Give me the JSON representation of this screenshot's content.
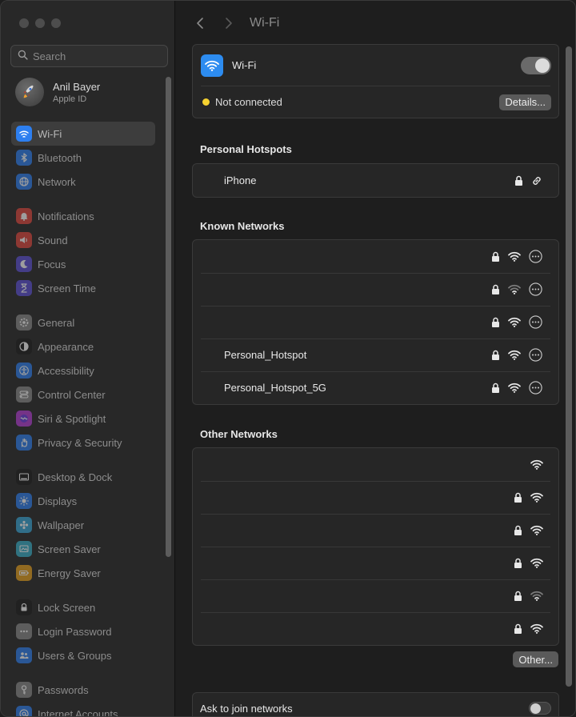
{
  "window": {
    "title": "Wi-Fi"
  },
  "search": {
    "placeholder": "Search"
  },
  "profile": {
    "name": "Anil Bayer",
    "subtitle": "Apple ID"
  },
  "sidebar": {
    "groups": [
      [
        {
          "label": "Wi-Fi",
          "icon": "wifi-icon",
          "color": "#2d7ff0",
          "active": true
        },
        {
          "label": "Bluetooth",
          "icon": "bluetooth-icon",
          "color": "#2d7ff0"
        },
        {
          "label": "Network",
          "icon": "globe-icon",
          "color": "#2d7ff0"
        }
      ],
      [
        {
          "label": "Notifications",
          "icon": "bell-icon",
          "color": "#e0463d"
        },
        {
          "label": "Sound",
          "icon": "speaker-icon",
          "color": "#e0463d"
        },
        {
          "label": "Focus",
          "icon": "moon-icon",
          "color": "#5b4fd6"
        },
        {
          "label": "Screen Time",
          "icon": "hourglass-icon",
          "color": "#5b4fd6"
        }
      ],
      [
        {
          "label": "General",
          "icon": "gear-icon",
          "color": "#8a8a8a"
        },
        {
          "label": "Appearance",
          "icon": "appearance-icon",
          "color": "#1c1c1c"
        },
        {
          "label": "Accessibility",
          "icon": "accessibility-icon",
          "color": "#2d7ff0"
        },
        {
          "label": "Control Center",
          "icon": "control-center-icon",
          "color": "#8a8a8a"
        },
        {
          "label": "Siri & Spotlight",
          "icon": "siri-icon",
          "color": "#b43dd6"
        },
        {
          "label": "Privacy & Security",
          "icon": "hand-icon",
          "color": "#2d7ff0"
        }
      ],
      [
        {
          "label": "Desktop & Dock",
          "icon": "dock-icon",
          "color": "#1c1c1c"
        },
        {
          "label": "Displays",
          "icon": "sun-icon",
          "color": "#2d7ff0"
        },
        {
          "label": "Wallpaper",
          "icon": "flower-icon",
          "color": "#37a7d8"
        },
        {
          "label": "Screen Saver",
          "icon": "screen-saver-icon",
          "color": "#37b0c8"
        },
        {
          "label": "Energy Saver",
          "icon": "battery-icon",
          "color": "#e8a01c"
        }
      ],
      [
        {
          "label": "Lock Screen",
          "icon": "lock-screen-icon",
          "color": "#1c1c1c"
        },
        {
          "label": "Login Password",
          "icon": "dots-icon",
          "color": "#8a8a8a"
        },
        {
          "label": "Users & Groups",
          "icon": "users-icon",
          "color": "#2d7ff0"
        }
      ],
      [
        {
          "label": "Passwords",
          "icon": "key-icon",
          "color": "#8a8a8a"
        },
        {
          "label": "Internet Accounts",
          "icon": "at-icon",
          "color": "#2d7ff0"
        }
      ]
    ]
  },
  "wifi": {
    "label": "Wi-Fi",
    "enabled": true,
    "status": "Not connected",
    "status_color": "#f5d130",
    "details_button": "Details..."
  },
  "hotspots": {
    "title": "Personal Hotspots",
    "items": [
      {
        "name": "iPhone"
      }
    ]
  },
  "known": {
    "title": "Known Networks",
    "items": [
      {
        "name": "",
        "strength": "full"
      },
      {
        "name": "",
        "strength": "weak"
      },
      {
        "name": "",
        "strength": "full"
      },
      {
        "name": "Personal_Hotspot",
        "strength": "full"
      },
      {
        "name": "Personal_Hotspot_5G",
        "strength": "full"
      }
    ]
  },
  "other": {
    "title": "Other Networks",
    "items": [
      {
        "name": "",
        "locked": false,
        "strength": "full"
      },
      {
        "name": "",
        "locked": true,
        "strength": "full"
      },
      {
        "name": "",
        "locked": true,
        "strength": "full"
      },
      {
        "name": "",
        "locked": true,
        "strength": "full"
      },
      {
        "name": "",
        "locked": true,
        "strength": "weak"
      },
      {
        "name": "",
        "locked": true,
        "strength": "full"
      }
    ],
    "other_button": "Other..."
  },
  "ask_join": {
    "label": "Ask to join networks",
    "enabled": false
  }
}
